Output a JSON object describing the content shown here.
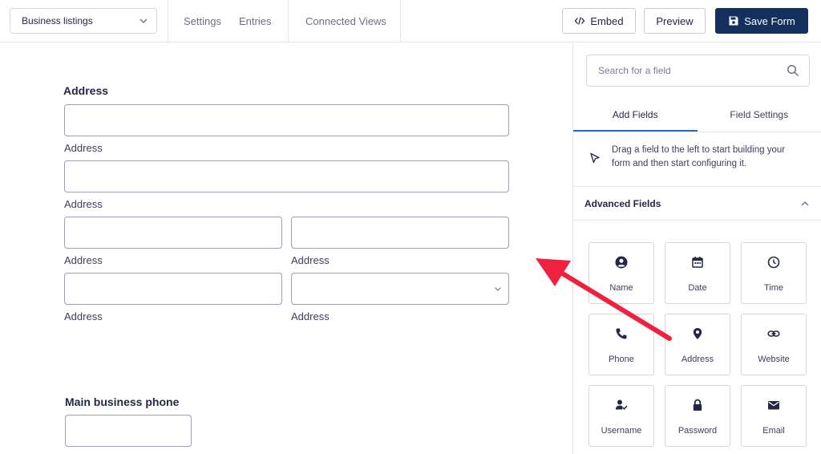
{
  "header": {
    "form_select": "Business listings",
    "nav": [
      "Settings",
      "Entries",
      "Connected Views"
    ],
    "embed_label": "Embed",
    "preview_label": "Preview",
    "save_label": "Save Form"
  },
  "canvas": {
    "address_title": "Address",
    "address_sublabels": [
      "Address",
      "Address",
      "Address",
      "Address",
      "Address",
      "Address"
    ],
    "phone_title": "Main business phone"
  },
  "panel": {
    "search_placeholder": "Search for a field",
    "tabs": [
      "Add Fields",
      "Field Settings"
    ],
    "hint": "Drag a field to the left to start building your form and then start configuring it.",
    "section_title": "Advanced Fields",
    "fields": [
      {
        "label": "Name",
        "icon": "user-circle-icon"
      },
      {
        "label": "Date",
        "icon": "calendar-icon"
      },
      {
        "label": "Time",
        "icon": "clock-icon"
      },
      {
        "label": "Phone",
        "icon": "phone-icon"
      },
      {
        "label": "Address",
        "icon": "map-pin-icon"
      },
      {
        "label": "Website",
        "icon": "link-icon"
      },
      {
        "label": "Username",
        "icon": "user-check-icon"
      },
      {
        "label": "Password",
        "icon": "lock-icon"
      },
      {
        "label": "Email",
        "icon": "envelope-icon"
      }
    ]
  },
  "colors": {
    "primary": "#14305c",
    "tab_accent": "#2e6ab8",
    "annotation_arrow": "#f0213e"
  }
}
